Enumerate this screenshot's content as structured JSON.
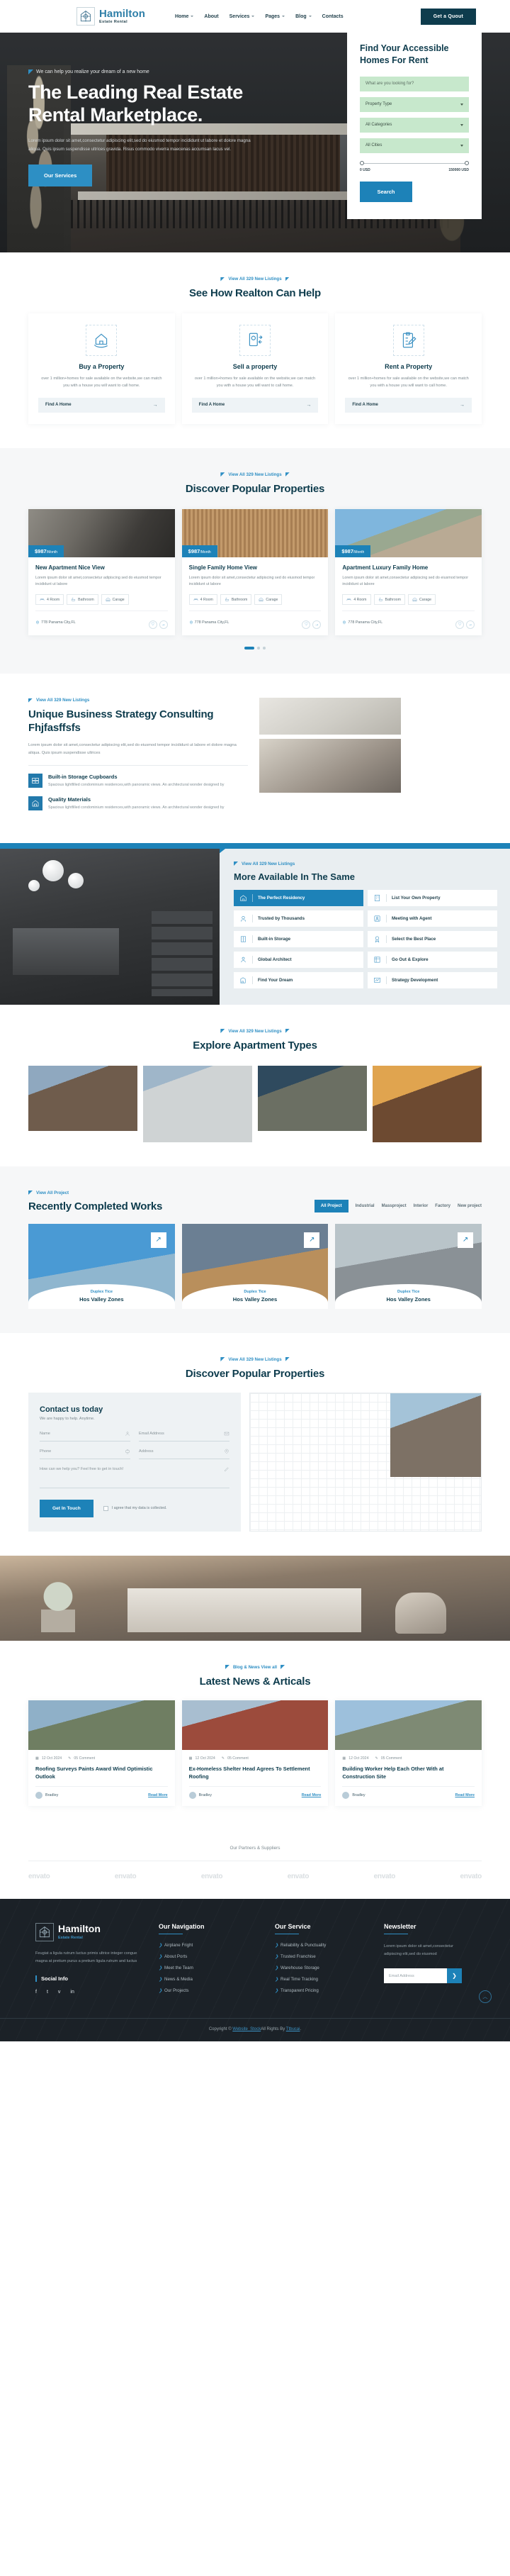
{
  "header": {
    "brand_name": "Hamilton",
    "brand_sub": "Estate Rental",
    "nav": [
      {
        "label": "Home",
        "caret": true
      },
      {
        "label": "About",
        "caret": false
      },
      {
        "label": "Services",
        "caret": true
      },
      {
        "label": "Pages",
        "caret": true
      },
      {
        "label": "Blog",
        "caret": true
      },
      {
        "label": "Contacts",
        "caret": false
      }
    ],
    "cta": "Get a Quout"
  },
  "hero": {
    "eyebrow": "We can help you realize your dream of a new home",
    "title": "The Leading Real Estate Rental Marketplace.",
    "paragraph": "Lorem ipsum dolor sit amet,consectetur adipiscing elit,sed do eiusmod tempor incididunt ut labore et dolore magna aliqua. Quis ipsum suspendisse ultrices gravida. Risus commodo viverra maecenas accumsan lacus vel.",
    "button": "Our Services",
    "search": {
      "title": "Find Your Accessible Homes For Rent",
      "keyword_placeholder": "What are you looking for?",
      "property_type": "Property Type",
      "categories": "All Categories",
      "cities": "All Cities",
      "price_min": "0 USD",
      "price_max": "150000 USD",
      "button": "Search"
    }
  },
  "help": {
    "eyebrow": "View All 329 New Listings",
    "title": "See How Realton Can Help",
    "cards": [
      {
        "icon": "house-hand-icon",
        "title": "Buy a Property",
        "text": "over 1 million+homes for sale available on the website,we can match you with a house you will want to call home.",
        "btn": "Find A Home"
      },
      {
        "icon": "sell-phone-icon",
        "title": "Sell a property",
        "text": "over 1 million+homes for sale available on the website,we can match you with a house you will want to call home.",
        "btn": "Find A Home"
      },
      {
        "icon": "clipboard-pen-icon",
        "title": "Rent a Property",
        "text": "over 1 million+homes for sale available on the website,we can match you with a house you will want to call home.",
        "btn": "Find A Home"
      }
    ]
  },
  "popular": {
    "eyebrow": "View All 329 New Listings",
    "title": "Discover Popular Properties",
    "cards": [
      {
        "price": "$987",
        "period": "/Month",
        "title": "New Apartment Nice View",
        "text": "Lorem ipsum dolor sit amet,consectetur adipiscing sed do eiusmod tempor incididunt ut labore",
        "rooms": "4 Room",
        "bath": "Bathroom",
        "garage": "Carage",
        "location": "778 Panama City,FL"
      },
      {
        "price": "$987",
        "period": "/Month",
        "title": "Single Family Home View",
        "text": "Lorem ipsum dolor sit amet,consectetur adipiscing sed do eiusmod tempor incididunt ut labore",
        "rooms": "4 Room",
        "bath": "Bathroom",
        "garage": "Carage",
        "location": "778 Panama City,FL"
      },
      {
        "price": "$987",
        "period": "/Month",
        "title": "Apartment Luxury Family Home",
        "text": "Lorem ipsum dolor sit amet,consectetur adipiscing sed do eiusmod tempor incididunt ut labore",
        "rooms": "4 Room",
        "bath": "Bathroom",
        "garage": "Carage",
        "location": "778 Panama City,FL"
      }
    ]
  },
  "unique": {
    "eyebrow": "View All 329 New Listings",
    "title": "Unique Business Strategy Consulting Fhjfasffsfs",
    "paragraph": "Lorem ipsum dolor sit amet,consectetur adipiscing elit,sed do eiusmod tempor incididunt ut labore et dolore magna aliqua. Quis ipsum suspendisse ultrices",
    "items": [
      {
        "icon": "storage-icon",
        "title": "Built-in Storage Cupboards",
        "text": "Spacious lightfilled condominium residences,with panoramic views. An architectural wonder designed by"
      },
      {
        "icon": "quality-icon",
        "title": "Quality Materials",
        "text": "Spacious lightfilled condominium residences,with panoramic views. An architectural wonder designed by"
      }
    ]
  },
  "more": {
    "eyebrow": "View All 329 New Listings",
    "title": "More Available In The Same",
    "items": [
      {
        "label": "The Perfect Residency",
        "icon": "residency-icon",
        "active": true
      },
      {
        "label": "List Your Own Property",
        "icon": "building-icon",
        "active": false
      },
      {
        "label": "Trusted by Thousands",
        "icon": "trust-icon",
        "active": false
      },
      {
        "label": "Meeting with Agent",
        "icon": "agent-icon",
        "active": false
      },
      {
        "label": "Built-in Storage",
        "icon": "storage2-icon",
        "active": false
      },
      {
        "label": "Select the Best Place",
        "icon": "badge-icon",
        "active": false
      },
      {
        "label": "Global Architect",
        "icon": "architect-icon",
        "active": false
      },
      {
        "label": "Go Out & Explore",
        "icon": "explore-icon",
        "active": false
      },
      {
        "label": "Find Your Dream",
        "icon": "dream-icon",
        "active": false
      },
      {
        "label": "Strategy Development",
        "icon": "strategy-icon",
        "active": false
      }
    ]
  },
  "apartments": {
    "eyebrow": "View All 329 New Listings",
    "title": "Explore Apartment Types"
  },
  "works": {
    "eyebrow": "View All Project",
    "title": "Recently Completed Works",
    "filters": [
      {
        "label": "All Project",
        "active": true
      },
      {
        "label": "Industrial",
        "active": false
      },
      {
        "label": "Massproject",
        "active": false
      },
      {
        "label": "Interior",
        "active": false
      },
      {
        "label": "Factory",
        "active": false
      },
      {
        "label": "New project",
        "active": false
      }
    ],
    "cards": [
      {
        "sub": "Duplex Tice",
        "title": "Hos Valley Zones"
      },
      {
        "sub": "Duplex Tice",
        "title": "Hos Valley Zones"
      },
      {
        "sub": "Duplex Tice",
        "title": "Hos Valley Zones"
      }
    ]
  },
  "contact": {
    "eyebrow": "View All 329 New Listings",
    "title": "Discover Popular Properties",
    "form_title": "Contact us today",
    "form_sub": "We are happy to help. Anytime.",
    "fields": [
      {
        "label": "Name",
        "icon": "user-icon"
      },
      {
        "label": "Email Address",
        "icon": "mail-icon"
      },
      {
        "label": "Phone",
        "icon": "phone-icon"
      },
      {
        "label": "Address",
        "icon": "pin-icon"
      }
    ],
    "message_placeholder": "How can we help you? Feel free to get in touch!",
    "button": "Get In Touch",
    "consent": "I agree that my data is collected."
  },
  "news": {
    "eyebrow": "Blog & News View all",
    "title": "Latest News & Articals",
    "cards": [
      {
        "date": "12 Oct 2024",
        "comments": "05 Comment",
        "title": "Roofing Surveys Paints Award Wind Optimistic Outlook",
        "author": "Bradley",
        "link": "Read More"
      },
      {
        "date": "12 Oct 2024",
        "comments": "05 Comment",
        "title": "Ex-Homeless Shelter Head Agrees To Settlement Roofing",
        "author": "Bradley",
        "link": "Read More"
      },
      {
        "date": "12 Oct 2024",
        "comments": "05 Comment",
        "title": "Building Worker Help Each Other With at Construction Site",
        "author": "Bradley",
        "link": "Read More"
      }
    ]
  },
  "partners": {
    "title": "Our Partners & Suppliers",
    "logos": [
      "envato",
      "envato",
      "envato",
      "envato",
      "envato",
      "envato"
    ]
  },
  "footer": {
    "brand_name": "Hamilton",
    "brand_sub": "Estate Rental",
    "about": "Feugiat a ligula rutrum luctus primis ultrice integer congue magna at pretium purus a pretium ligula rutrum and luctus",
    "social_title": "Social Info",
    "socials": [
      "f",
      "t",
      "v",
      "in"
    ],
    "nav_title": "Our Navigation",
    "nav_links": [
      "Airplane Fright",
      "About Ports",
      "Meet the Team",
      "News & Media",
      "Our Projects"
    ],
    "service_title": "Our Service",
    "service_links": [
      "Reliability & Punctuality",
      "Trusted Franchise",
      "Warehouse Storage",
      "Real Time Tracking",
      "Transparent Pricing"
    ],
    "news_title": "Newsletter",
    "news_text": "Lorem ipsum dolor sit amet,consectetur adipiscing elit,sed do eiusmod",
    "email_placeholder": "Email Address",
    "copyright_pre": "Copyright © ",
    "copyright_link1": "Website_Stock",
    "copyright_mid": "All Rights By ",
    "copyright_link2": "Ttbucai",
    "copyright_end": "."
  }
}
